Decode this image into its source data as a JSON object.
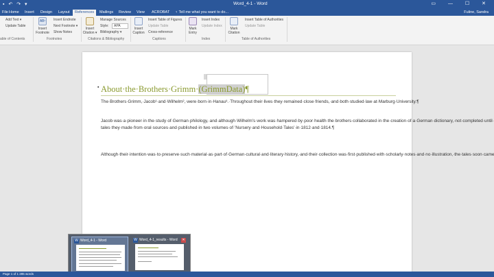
{
  "titlebar": {
    "qat": "▪ ↶ ↷ ▾",
    "title": "Word_4-1 - Word",
    "controls": "▭ — ☐ ✕"
  },
  "tabs": {
    "items": [
      "File",
      "Home",
      "Insert",
      "Design",
      "Layout",
      "References",
      "Mailings",
      "Review",
      "View",
      "ACROBAT"
    ],
    "active": "References",
    "tellme": "♀ Tell me what you want to do...",
    "user": "Fuline, Sandra"
  },
  "ribbon": {
    "add_text": "Add Text ▾",
    "update_table": "Update Table",
    "table_of_contents_group": "able of Contents",
    "insert_footnote": "Insert\nFootnote",
    "insert_endnote": "Insert Endnote",
    "next_footnote": "Next Footnote ▾",
    "show_notes": "Show Notes",
    "footnotes_group": "Footnotes",
    "insert_citation": "Insert\nCitation ▾",
    "manage_sources": "Manage Sources",
    "style_label": "Style:",
    "style_value": "APA",
    "bibliography": "Bibliography ▾",
    "citations_group": "Citations & Bibliography",
    "insert_caption": "Insert\nCaption",
    "insert_table_of_figures": "Insert Table of Figures",
    "update_table_captions": "Update Table",
    "cross_reference": "Cross-reference",
    "captions_group": "Captions",
    "mark_entry": "Mark\nEntry",
    "insert_index": "Insert Index",
    "update_index": "Update Index",
    "index_group": "Index",
    "mark_citation": "Mark\nCitation",
    "insert_table_of_authorities": "Insert Table of Authorities",
    "update_table_authorities": "Update Table",
    "authorities_group": "Table of Authorities"
  },
  "document": {
    "heading_text": "About·the·Brothers·Grimm·",
    "heading_field": "(GrimmData)",
    "heading_end": "¶",
    "paragraphs": [
      "The·Brothers·Grimm,·Jacob¹·and·Wilhelm²,·were·born·in·Hanau³.·Throughout·their·lives·they·remained·close·friends,·and·both·studied·law·at·Marburg·University.¶",
      "Jacob·was·a·pioneer·in·the·study·of·German·philology,·and·although·Wilhelm's·work·was·hampered·by·poor·health·the·brothers·collaborated·in·the·creation·of·a·German·dictionary,·not·completed·until·a·century·after·their·deaths.·But·they·were·best·(and·universally)·known·for·the·collection·of·over·two·hundred·folk-tales·they·made·from·oral·sources·and·published·in·two·volumes·of·'Nursery·and·Household·Tales'·in·1812·and·1814.¶",
      "Although·their·intention·was·to·preserve·such·material·as·part·of·German·cultural·and·literary·history,·and·their·collection·was·first·published·with·scholarly·notes·and·no·illustration,·the·tales·soon·came·into·the·possession·of·young·readers.·This·was·in·part·due·to·Edgar·Taylor,·who·made·the·first·English·translation·in·1823,·selecting·about·fifty·stories·'with·the·amusement·of·some·young·friends·principally·in·view.'·They·have·been·an·essential·ingredient·of·children's·reading·ever·since.¶"
    ]
  },
  "taskbar_preview": {
    "windows": [
      {
        "title": "Word_4-1 - Word",
        "icon": "W"
      },
      {
        "title": "Word_4-1_results - Word",
        "icon": "W"
      }
    ],
    "close_glyph": "✕"
  },
  "status": {
    "text": "Page 1 of 1   285 words"
  }
}
